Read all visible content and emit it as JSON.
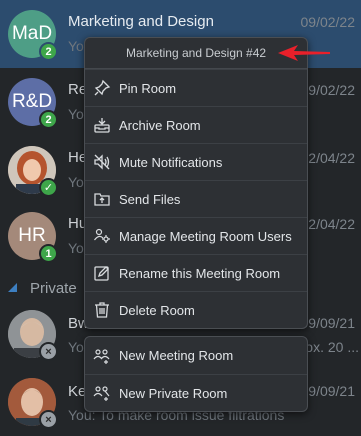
{
  "rooms": [
    {
      "initials": "MaD",
      "name": "Marketing and Design",
      "date": "09/02/22",
      "preview": "You",
      "badge": "2",
      "color": "#4e9e86"
    },
    {
      "initials": "R&D",
      "name": "Re",
      "date": "09/02/22",
      "preview": "You",
      "badge": "2",
      "color": "#5d6ea6"
    },
    {
      "initials": "",
      "name": "He",
      "date": "2/04/22",
      "preview": "You",
      "badge": "✓"
    },
    {
      "initials": "HR",
      "name": "Hu",
      "date": "2/04/22",
      "preview": "You",
      "badge": "1",
      "color": "#a4897a"
    },
    {
      "initials": "",
      "name": "Bw",
      "date": "09/09/21",
      "preview": "You",
      "extra": "ox. 20 ...",
      "badge": "×"
    },
    {
      "initials": "",
      "name": "Ke",
      "date": "09/09/21",
      "preview": "You: To make room issue filtrations",
      "badge": "×"
    }
  ],
  "section": {
    "label": "Private"
  },
  "context_menu": {
    "header": "Marketing and Design #42",
    "items": [
      {
        "label": "Pin Room",
        "icon": "pin-icon"
      },
      {
        "label": "Archive Room",
        "icon": "archive-icon"
      },
      {
        "label": "Mute Notifications",
        "icon": "mute-icon"
      },
      {
        "label": "Send Files",
        "icon": "send-files-icon"
      },
      {
        "label": "Manage Meeting Room Users",
        "icon": "manage-users-icon"
      },
      {
        "label": "Rename this Meeting Room",
        "icon": "rename-icon"
      },
      {
        "label": "Delete Room",
        "icon": "trash-icon"
      }
    ]
  },
  "create_menu": {
    "items": [
      {
        "label": "New Meeting Room",
        "icon": "new-meeting-room-icon"
      },
      {
        "label": "New Private Room",
        "icon": "new-private-room-icon"
      }
    ]
  },
  "colors": {
    "selected_row": "#2c4c6e",
    "arrow": "#e8202a",
    "badge_green": "#3ea64a"
  }
}
